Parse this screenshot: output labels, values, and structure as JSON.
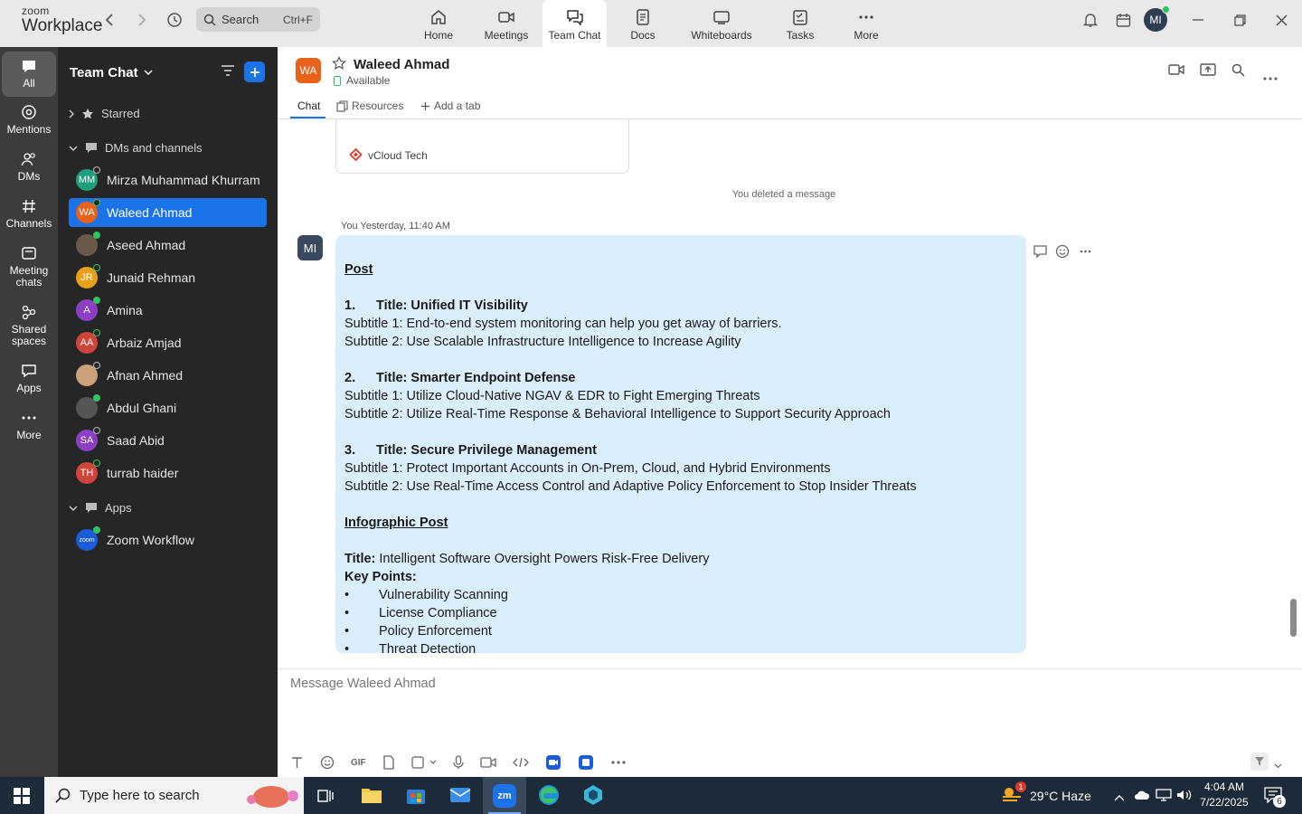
{
  "app": {
    "brand_top": "zoom",
    "brand_bottom": "Workplace"
  },
  "search": {
    "placeholder": "Search",
    "shortcut": "Ctrl+F"
  },
  "nav_tabs": [
    "Home",
    "Meetings",
    "Team Chat",
    "Docs",
    "Whiteboards",
    "Tasks",
    "More"
  ],
  "user": {
    "initials": "MI"
  },
  "rail": [
    "All",
    "Mentions",
    "DMs",
    "Channels",
    "Meeting chats",
    "Shared spaces",
    "Apps",
    "More"
  ],
  "sidebar": {
    "title": "Team Chat",
    "sections": {
      "starred": "Starred",
      "dms": "DMs and channels",
      "apps": "Apps"
    },
    "contacts": [
      {
        "initials": "MM",
        "name": "Mirza Muhammad Khurram",
        "color": "#1f9e7a"
      },
      {
        "initials": "WA",
        "name": "Waleed Ahmad",
        "color": "#e8621a"
      },
      {
        "initials": "",
        "name": "Aseed Ahmad",
        "color": "#6b5a4a"
      },
      {
        "initials": "JR",
        "name": "Junaid Rehman",
        "color": "#e8a21a"
      },
      {
        "initials": "A",
        "name": "Amina",
        "color": "#8a3fc4"
      },
      {
        "initials": "AA",
        "name": "Arbaiz Amjad",
        "color": "#d0453a"
      },
      {
        "initials": "",
        "name": "Afnan Ahmed",
        "color": "#c9a07a"
      },
      {
        "initials": "",
        "name": "Abdul Ghani",
        "color": "#555555"
      },
      {
        "initials": "SA",
        "name": "Saad Abid",
        "color": "#8a3fc4"
      },
      {
        "initials": "TH",
        "name": "turrab haider",
        "color": "#d0453a"
      }
    ],
    "apps": [
      {
        "initials": "zoom",
        "name": "Zoom Workflow",
        "color": "#1a5cd8"
      }
    ]
  },
  "chat": {
    "name": "Waleed Ahmad",
    "initials": "WA",
    "status": "Available",
    "tabs": {
      "chat": "Chat",
      "resources": "Resources",
      "add": "Add a tab"
    },
    "card_label": "vCloud Tech",
    "system_msg": "You deleted a message",
    "meta": "You Yesterday, 11:40 AM",
    "sender_initials": "MI",
    "message": {
      "post_heading": "Post",
      "items": [
        {
          "num": "1.",
          "title": "Title: Unified IT Visibility",
          "s1": "Subtitle 1: End-to-end system monitoring can help you get away of barriers.",
          "s2": "Subtitle 2: Use Scalable Infrastructure Intelligence to Increase Agility"
        },
        {
          "num": "2.",
          "title": "Title: Smarter Endpoint Defense",
          "s1": "Subtitle 1: Utilize Cloud-Native NGAV & EDR to Fight Emerging Threats",
          "s2": "Subtitle 2: Utilize Real-Time Response & Behavioral Intelligence to Support Security Approach"
        },
        {
          "num": "3.",
          "title": "Title: Secure Privilege Management",
          "s1": "Subtitle 1: Protect Important Accounts in On-Prem, Cloud, and Hybrid Environments",
          "s2": "Subtitle 2:  Use Real-Time Access Control and Adaptive Policy Enforcement to Stop Insider Threats"
        }
      ],
      "info_heading": "Infographic Post",
      "info_title_label": "Title:",
      "info_title": " Intelligent Software Oversight Powers Risk-Free Delivery",
      "key_points_label": "Key Points:",
      "bullets": [
        "Vulnerability Scanning",
        "License Compliance",
        "Policy Enforcement",
        "Threat Detection"
      ]
    },
    "composer_placeholder": "Message Waleed Ahmad",
    "gif_label": "GIF"
  },
  "taskbar": {
    "search_placeholder": "Type here to search",
    "weather": "29°C  Haze",
    "weather_badge": "1",
    "time": "4:04 AM",
    "date": "7/22/2025",
    "notif_count": "6",
    "zoom_label": "zm"
  }
}
